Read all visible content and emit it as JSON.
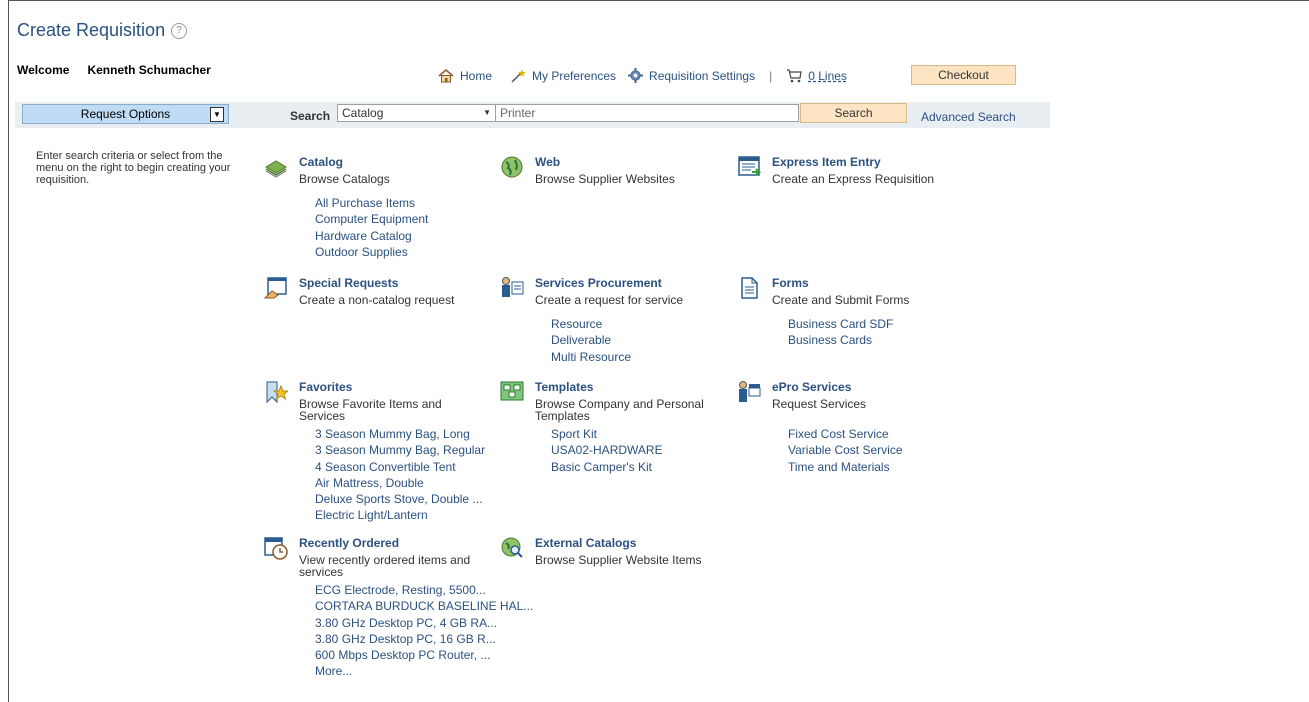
{
  "title": "Create Requisition",
  "welcome": {
    "label": "Welcome",
    "user": "Kenneth Schumacher"
  },
  "nav": {
    "home": "Home",
    "preferences": "My Preferences",
    "settings": "Requisition Settings",
    "separator": "|",
    "lines": "0 Lines",
    "checkout": "Checkout"
  },
  "search": {
    "request_options": "Request Options",
    "label": "Search",
    "scope": "Catalog",
    "query": "Printer",
    "button": "Search",
    "advanced": "Advanced Search"
  },
  "intro": "Enter search criteria or select from the menu on the right to begin creating your requisition.",
  "tiles": {
    "catalog": {
      "title": "Catalog",
      "desc": "Browse Catalogs",
      "links": [
        "All Purchase Items",
        "Computer Equipment",
        "Hardware Catalog",
        "Outdoor Supplies"
      ]
    },
    "web": {
      "title": "Web",
      "desc": "Browse Supplier Websites"
    },
    "express": {
      "title": "Express Item Entry",
      "desc": "Create an Express Requisition"
    },
    "special": {
      "title": "Special Requests",
      "desc": "Create a non-catalog request"
    },
    "services": {
      "title": "Services Procurement",
      "desc": "Create a request for service",
      "links": [
        "Resource",
        "Deliverable",
        "Multi Resource"
      ]
    },
    "forms": {
      "title": "Forms",
      "desc": "Create and Submit Forms",
      "links": [
        "Business Card SDF",
        "Business Cards"
      ]
    },
    "favorites": {
      "title": "Favorites",
      "desc": "Browse Favorite Items and Services",
      "links": [
        "3 Season Mummy Bag, Long",
        "3 Season Mummy Bag, Regular",
        "4 Season Convertible Tent",
        "Air Mattress, Double",
        "Deluxe Sports Stove, Double ...",
        "Electric Light/Lantern"
      ]
    },
    "templates": {
      "title": "Templates",
      "desc": "Browse Company and Personal Templates",
      "links": [
        "Sport Kit",
        "USA02-HARDWARE",
        "Basic Camper's Kit"
      ]
    },
    "epro": {
      "title": "ePro Services",
      "desc": "Request Services",
      "links": [
        "Fixed Cost Service",
        "Variable Cost Service",
        "Time and Materials"
      ]
    },
    "recent": {
      "title": "Recently Ordered",
      "desc": "View recently ordered items and services",
      "links": [
        "ECG Electrode, Resting, 5500...",
        "CORTARA BURDUCK BASELINE HAL...",
        "3.80 GHz Desktop PC, 4 GB RA...",
        "3.80 GHz Desktop PC, 16 GB R...",
        "600 Mbps Desktop PC Router, ...",
        "More..."
      ]
    },
    "external": {
      "title": "External Catalogs",
      "desc": "Browse Supplier Website Items"
    }
  }
}
